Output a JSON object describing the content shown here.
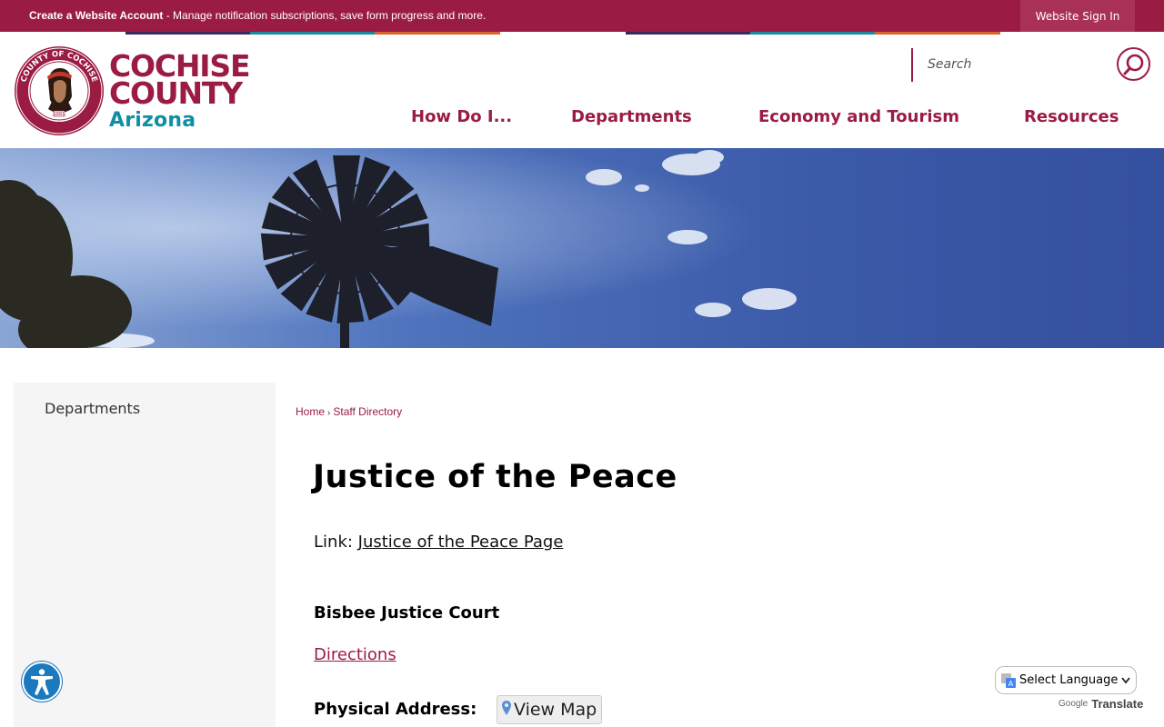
{
  "topbar": {
    "create_account": "Create a Website Account",
    "message": " - Manage notification subscriptions, save form progress and more.",
    "sign_in": "Website Sign In"
  },
  "logo": {
    "line1": "COCHISE",
    "line2": "COUNTY",
    "line3": "Arizona",
    "seal_text_top": "COUNTY OF COCHISE",
    "seal_text_bottom": "ARIZONA",
    "seal_year": "1881"
  },
  "search": {
    "placeholder": "Search"
  },
  "nav": {
    "items": [
      {
        "label": "How Do I..."
      },
      {
        "label": "Departments"
      },
      {
        "label": "Economy and Tourism"
      },
      {
        "label": "Resources"
      }
    ]
  },
  "sidebar": {
    "title": "Departments"
  },
  "breadcrumb": {
    "home": "Home",
    "separator": "›",
    "current": "Staff Directory"
  },
  "content": {
    "title": "Justice of the Peace",
    "link_prefix": "Link: ",
    "link_text": "Justice of the Peace Page",
    "court_name": "Bisbee Justice Court",
    "directions": "Directions",
    "physical_address_label": "Physical Address:",
    "view_map": "View Map"
  },
  "translate": {
    "select_label": "Select Language",
    "powered_by": "Google",
    "translate_label": "Translate"
  },
  "colors": {
    "brand": "#9b1c42",
    "accent": "#0f8fa3",
    "accessibility": "#1a79bf"
  },
  "icons": [
    "search-icon",
    "accessibility-icon",
    "map-pin-icon",
    "google-translate-icon",
    "dropdown-caret-icon",
    "county-seal"
  ]
}
